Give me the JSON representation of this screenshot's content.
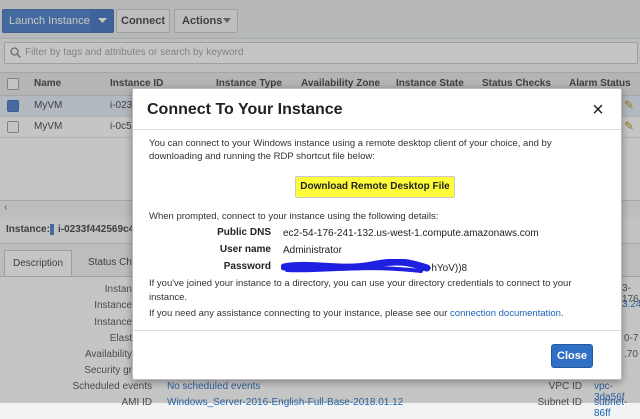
{
  "toolbar": {
    "launch_label": "Launch Instance",
    "connect_label": "Connect",
    "actions_label": "Actions"
  },
  "search": {
    "placeholder": "Filter by tags and attributes or search by keyword"
  },
  "table": {
    "columns": [
      "Name",
      "Instance ID",
      "Instance Type",
      "Availability Zone",
      "Instance State",
      "Status Checks",
      "Alarm Status"
    ],
    "rows": [
      {
        "name": "MyVM",
        "id": "i-023",
        "selected": true
      },
      {
        "name": "MyVM",
        "id": "i-0c5",
        "selected": false
      }
    ]
  },
  "details": {
    "instance_label": "Instance:",
    "instance_id": "i-0233f442569c4",
    "tabs": [
      "Description",
      "Status Ch"
    ],
    "fields": [
      {
        "label": "Instan",
        "value": ""
      },
      {
        "label": "Instance",
        "value": ""
      },
      {
        "label": "Instance",
        "value": ""
      },
      {
        "label": "Elast",
        "value": ""
      },
      {
        "label": "Availability",
        "value": ""
      },
      {
        "label": "Security gr",
        "value": ""
      },
      {
        "label": "Scheduled events",
        "value": "No scheduled events"
      },
      {
        "label": "AMI ID",
        "value": "Windows_Server-2016-English-Full-Base-2018.01.12"
      }
    ],
    "right_fields": [
      {
        "label": "VPC ID",
        "value": "vpc-3da56f"
      },
      {
        "label": "Subnet ID",
        "value": "subnet-86ff"
      }
    ],
    "right_values": [
      "3-176",
      "3.241",
      "0-7",
      ".70"
    ]
  },
  "modal": {
    "title": "Connect To Your Instance",
    "close_icon": "×",
    "intro_line1": "You can connect to your Windows instance using a remote desktop client of your choice, and by",
    "intro_line2": "downloading and running the RDP shortcut file below:",
    "download_label": "Download Remote Desktop File",
    "when_prompted": "When prompted, connect to your instance using the following details:",
    "public_dns_label": "Public DNS",
    "public_dns_value": "ec2-54-176-241-132.us-west-1.compute.amazonaws.com",
    "user_label": "User name",
    "user_value": "Administrator",
    "password_label": "Password",
    "password_value": "x-hYoV))8",
    "joined_line1": "If you've joined your instance to a directory, you can use your directory credentials to connect to your",
    "joined_line2": "instance.",
    "assist_prefix": "If you need any assistance connecting to your instance, please see our",
    "assist_link": "connection documentation",
    "assist_suffix": ".",
    "close_label": "Close"
  },
  "colors": {
    "accent": "#3a73c5",
    "highlight": "#fffd3a",
    "redaction": "#1f1fe0"
  }
}
